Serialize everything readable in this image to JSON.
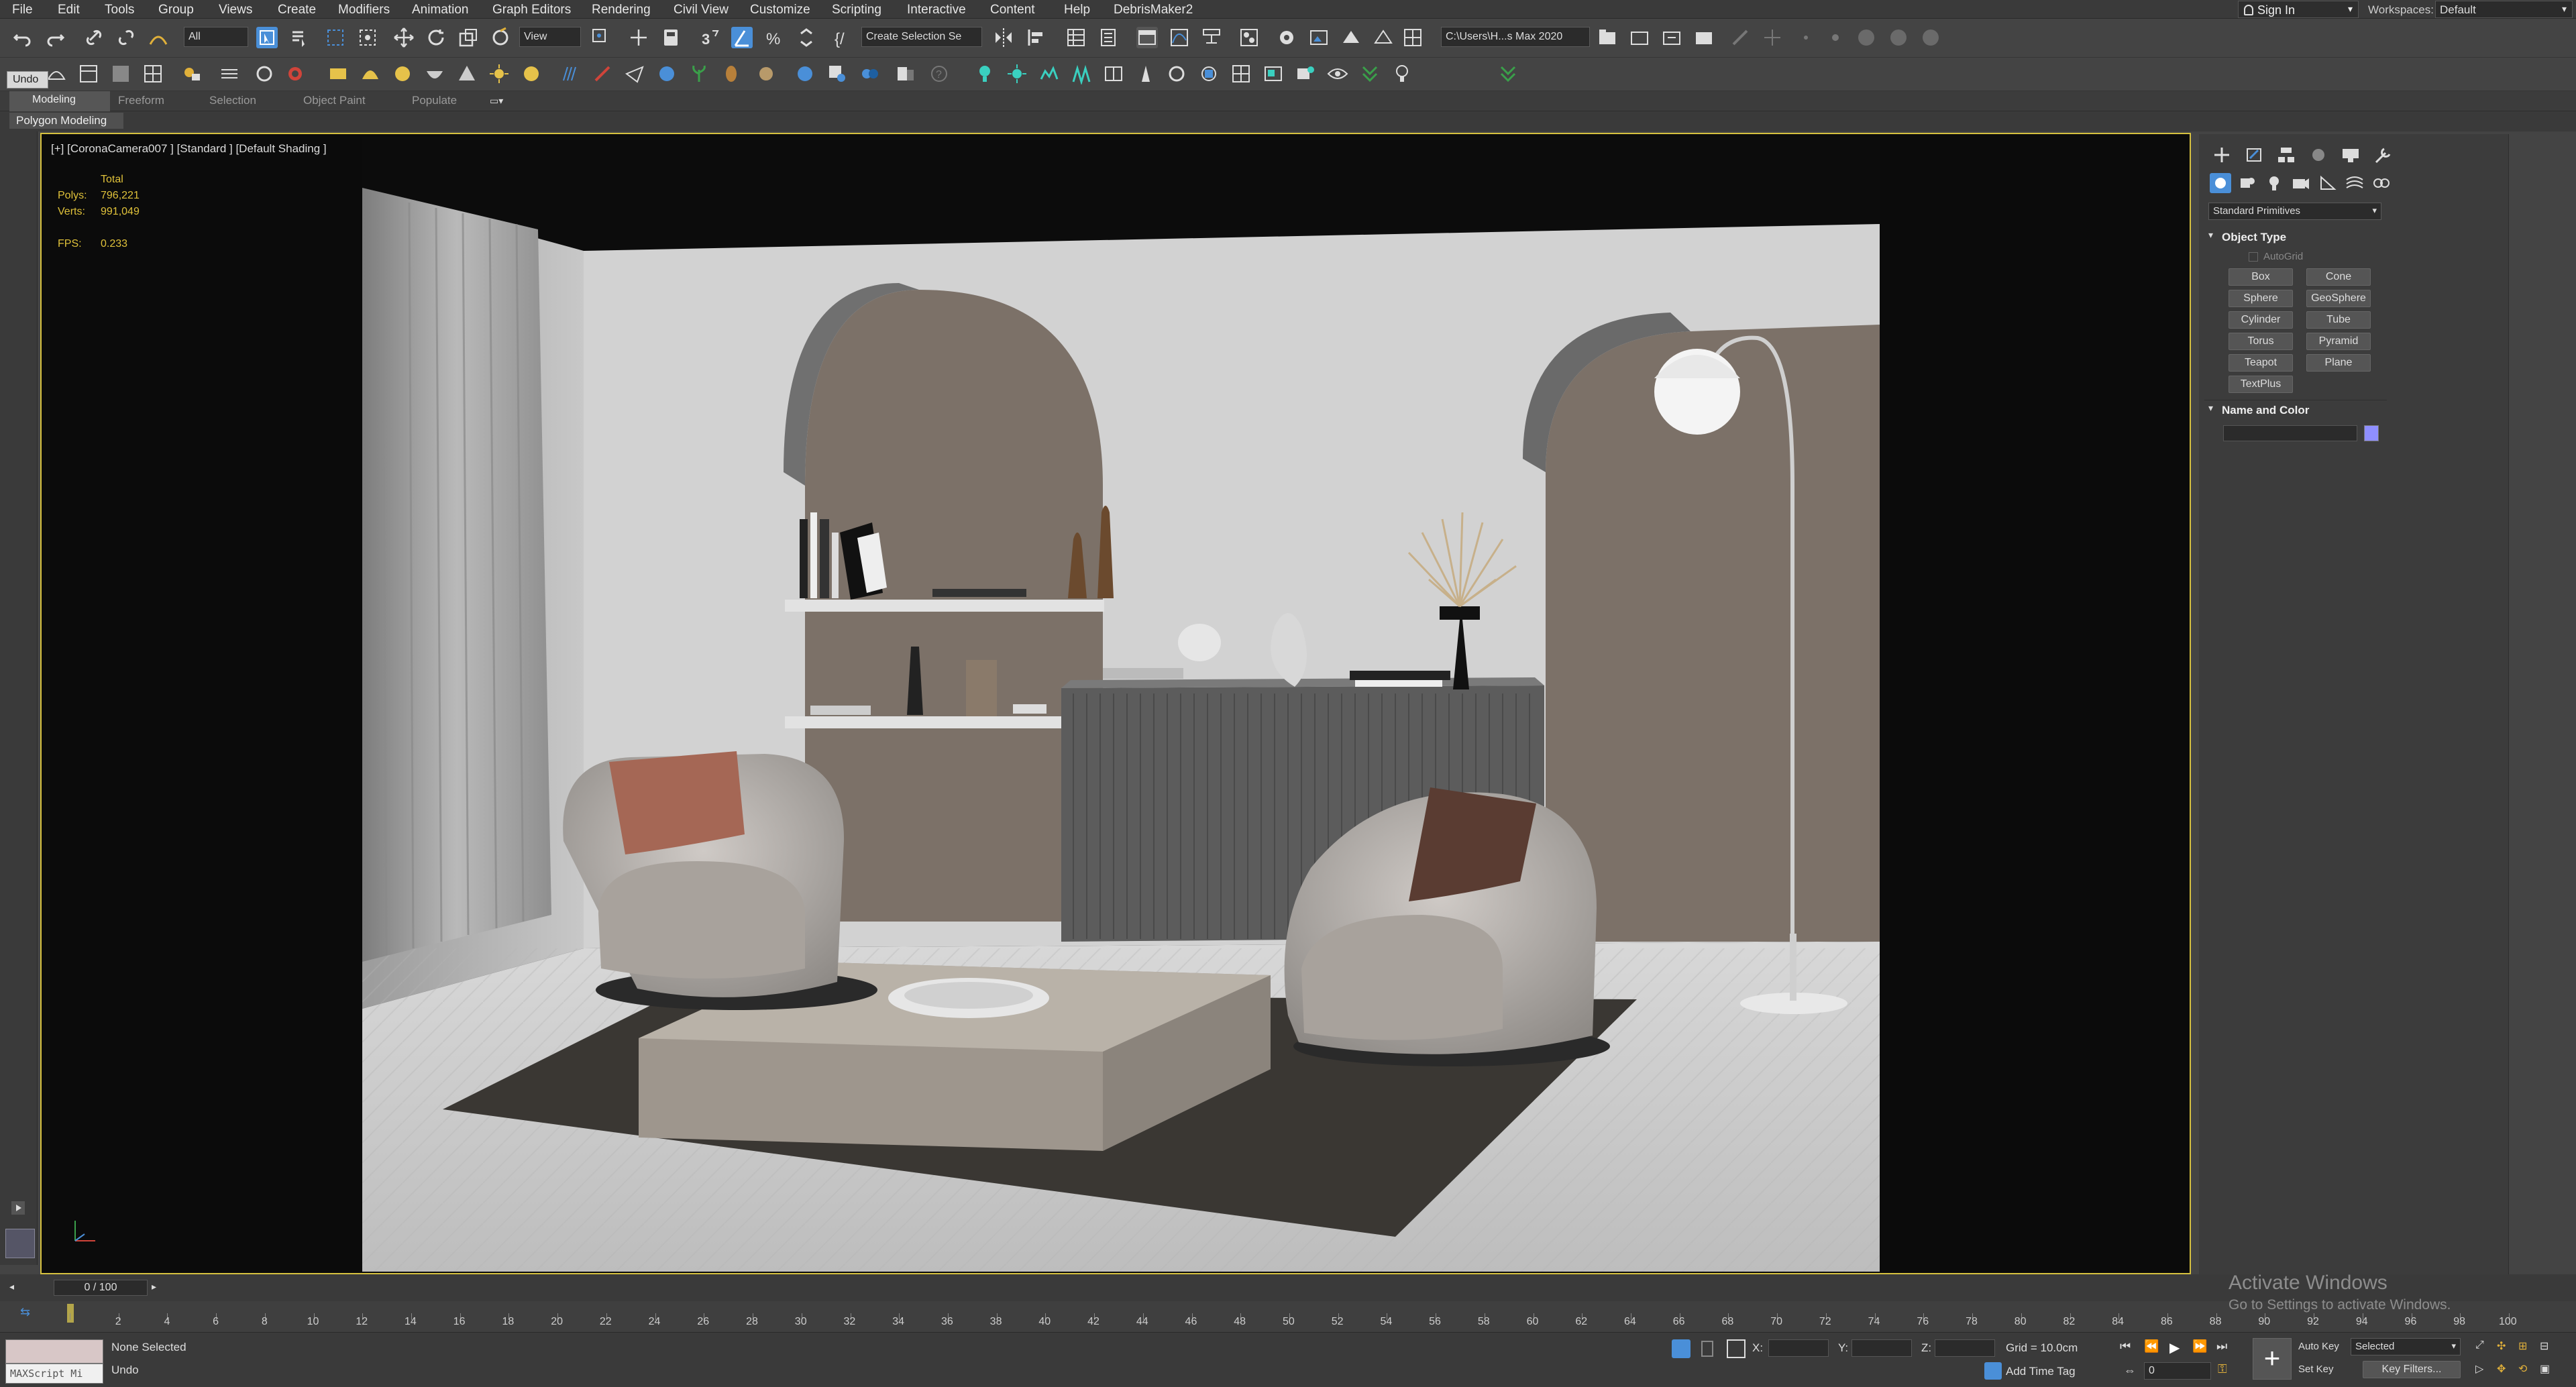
{
  "menu": [
    "File",
    "Edit",
    "Tools",
    "Group",
    "Views",
    "Create",
    "Modifiers",
    "Animation",
    "Graph Editors",
    "Rendering",
    "Civil View",
    "Customize",
    "Scripting",
    "Interactive",
    "Content",
    "Help",
    "DebrisMaker2"
  ],
  "signin": "Sign In",
  "workspaces_label": "Workspaces:",
  "workspaces_value": "Default",
  "toolbar": {
    "selection_filter": "All",
    "ref_coord": "View",
    "selection_set": "Create Selection Se",
    "project_path": "C:\\Users\\H...s Max 2020"
  },
  "undo_tooltip": "Undo",
  "ribbon": {
    "tabs": [
      "Modeling",
      "Freeform",
      "Selection",
      "Object Paint",
      "Populate"
    ],
    "active": "Modeling",
    "sub_label": "Polygon Modeling"
  },
  "viewport": {
    "label": "[+] [CoronaCamera007 ] [Standard ] [Default Shading ]",
    "stats_header": "Total",
    "polys_label": "Polys:",
    "polys": "796,221",
    "verts_label": "Verts:",
    "verts": "991,049",
    "fps_label": "FPS:",
    "fps": "0.233"
  },
  "command_panel": {
    "category": "Standard Primitives",
    "object_type_title": "Object Type",
    "autogrid": "AutoGrid",
    "buttons": [
      "Box",
      "Cone",
      "Sphere",
      "GeoSphere",
      "Cylinder",
      "Tube",
      "Torus",
      "Pyramid",
      "Teapot",
      "Plane",
      "TextPlus"
    ],
    "name_color_title": "Name and Color",
    "object_color": "#8f8fff"
  },
  "timeline": {
    "frame_display": "0 / 100",
    "ticks": [
      "0",
      "2",
      "4",
      "6",
      "8",
      "10",
      "12",
      "14",
      "16",
      "18",
      "20",
      "22",
      "24",
      "26",
      "28",
      "30",
      "32",
      "34",
      "36",
      "38",
      "40",
      "42",
      "44",
      "46",
      "48",
      "50",
      "52",
      "54",
      "56",
      "58",
      "60",
      "62",
      "64",
      "66",
      "68",
      "70",
      "72",
      "74",
      "76",
      "78",
      "80",
      "82",
      "84",
      "86",
      "88",
      "90",
      "92",
      "94",
      "96",
      "98",
      "100"
    ]
  },
  "status": {
    "maxscript": "MAXScript Mi",
    "selection": "None Selected",
    "prompt": "Undo",
    "x_label": "X:",
    "y_label": "Y:",
    "z_label": "Z:",
    "grid": "Grid = 10.0cm",
    "add_time_tag": "Add Time Tag",
    "auto_key": "Auto Key",
    "set_key": "Set Key",
    "key_mode": "Selected",
    "key_filters": "Key Filters...",
    "frame": "0"
  },
  "watermark": {
    "line1": "Activate Windows",
    "line2": "Go to Settings to activate Windows."
  },
  "colors": {
    "viewport_border": "#d6c13f",
    "stats_text": "#e0c23a",
    "accent_blue": "#4a8fd8"
  }
}
